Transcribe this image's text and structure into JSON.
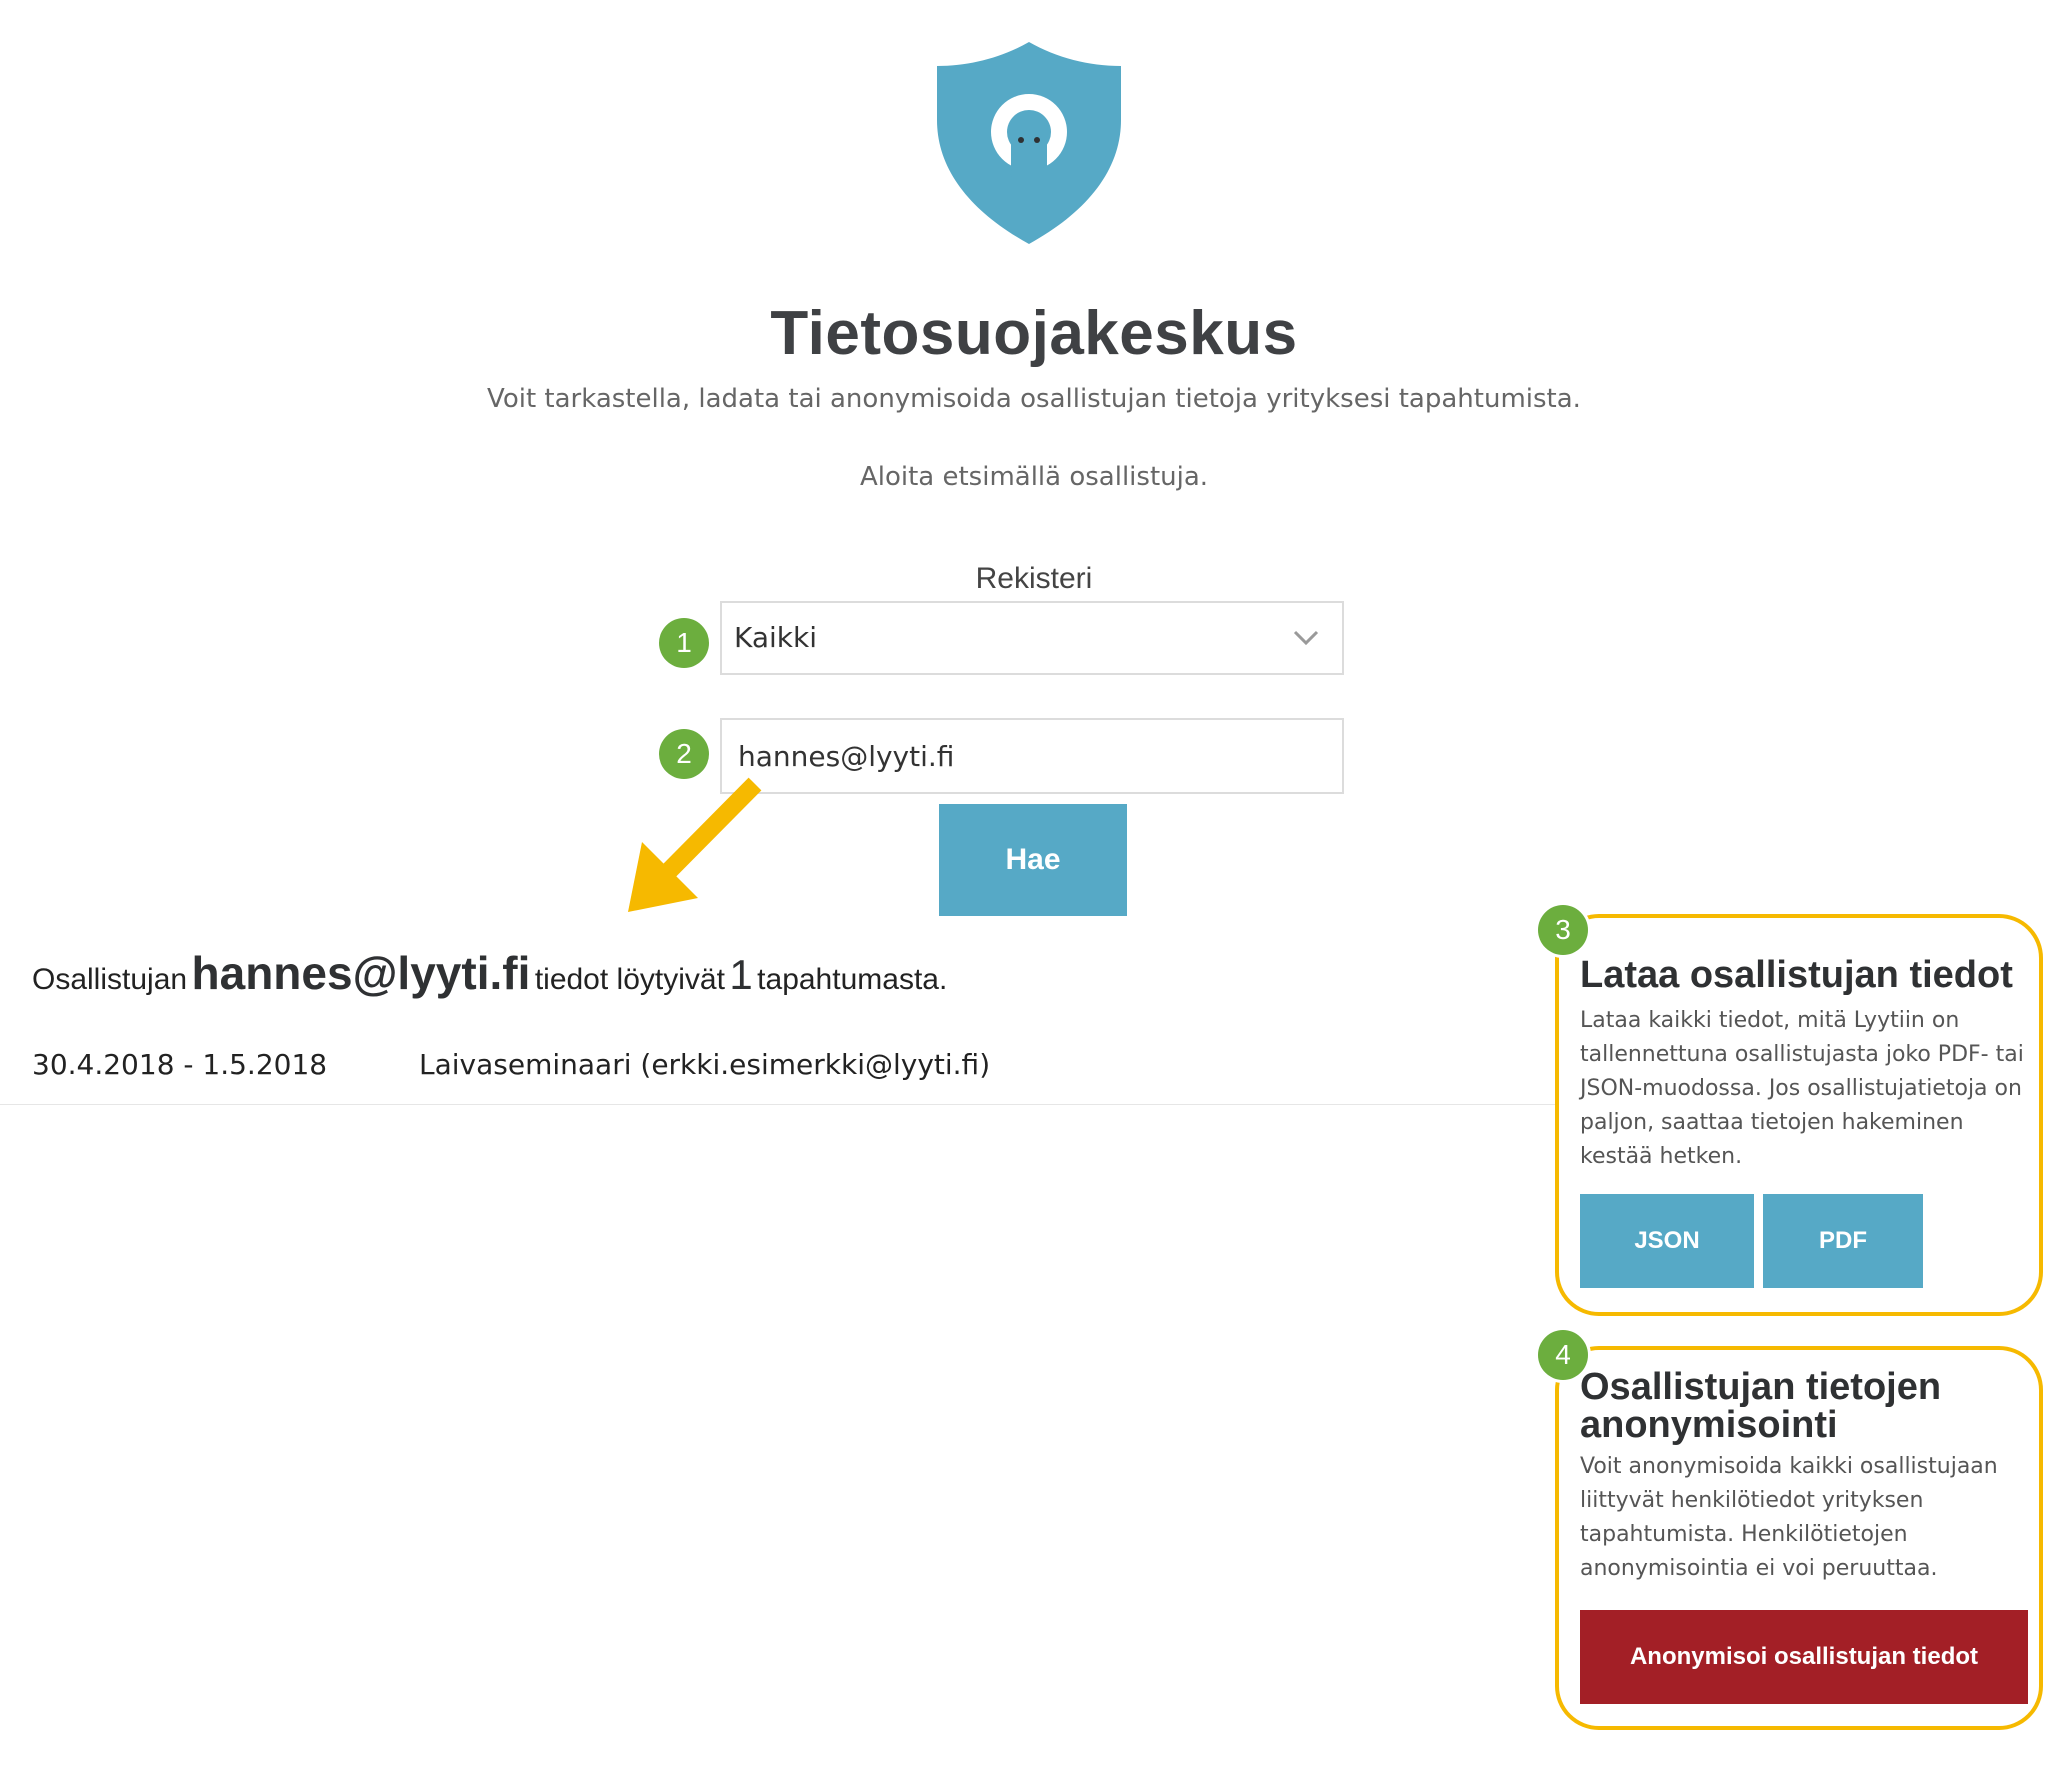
{
  "header": {
    "title": "Tietosuojakeskus",
    "subtitle": "Voit tarkastella, ladata tai anonymisoida osallistujan tietoja yrityksesi tapahtumista.",
    "hint": "Aloita etsimällä osallistuja."
  },
  "form": {
    "register_label": "Rekisteri",
    "register_value": "Kaikki",
    "email_value": "hannes@lyyti.fi",
    "search_label": "Hae"
  },
  "steps": [
    "1",
    "2",
    "3",
    "4"
  ],
  "result": {
    "prefix": "Osallistujan",
    "email": "hannes@lyyti.fi",
    "middle": "tiedot löytyivät",
    "count": "1",
    "suffix": "tapahtumasta."
  },
  "events": [
    {
      "dates": "30.4.2018 - 1.5.2018",
      "name": "Laivaseminaari (erkki.esimerkki@lyyti.fi)"
    }
  ],
  "download_panel": {
    "title": "Lataa osallistujan tiedot",
    "text": "Lataa kaikki tiedot, mitä Lyytiin on tallennettuna osallistujasta joko PDF- tai JSON-muodossa. Jos osallistujatietoja on paljon, saattaa tietojen hakeminen kestää hetken.",
    "json_label": "JSON",
    "pdf_label": "PDF"
  },
  "anonymize_panel": {
    "title": "Osallistujan tietojen anonymisointi",
    "text": "Voit anonymisoida kaikki osallistujaan liittyvät henkilötiedot yrityksen tapahtumista. Henkilötietojen anonymisointia ei voi peruuttaa.",
    "button_label": "Anonymisoi osallistujan tiedot"
  },
  "colors": {
    "brand": "#56a9c6",
    "step_badge": "#6cae3e",
    "highlight": "#f6b900",
    "danger": "#a31f26"
  },
  "icons": [
    "shield-logo-icon",
    "chevron-down-icon",
    "arrow-icon"
  ]
}
